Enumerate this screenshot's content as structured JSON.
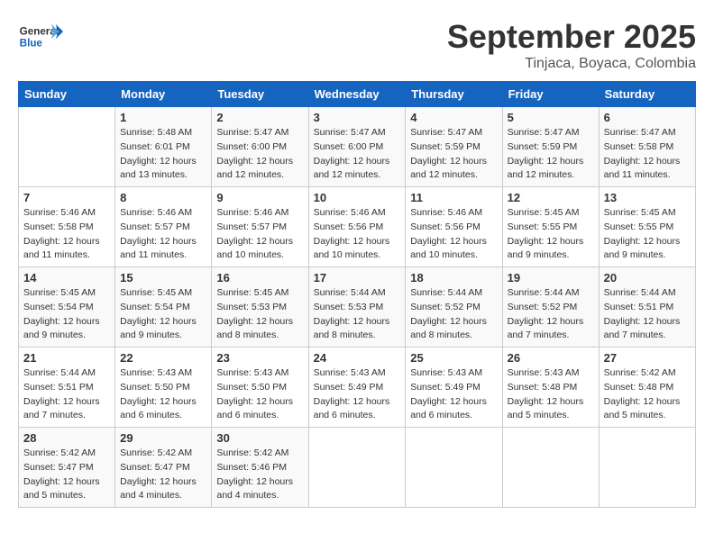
{
  "header": {
    "logo_line1": "General",
    "logo_line2": "Blue",
    "month": "September 2025",
    "location": "Tinjaca, Boyaca, Colombia"
  },
  "days_of_week": [
    "Sunday",
    "Monday",
    "Tuesday",
    "Wednesday",
    "Thursday",
    "Friday",
    "Saturday"
  ],
  "weeks": [
    [
      {
        "day": "",
        "info": ""
      },
      {
        "day": "1",
        "info": "Sunrise: 5:48 AM\nSunset: 6:01 PM\nDaylight: 12 hours\nand 13 minutes."
      },
      {
        "day": "2",
        "info": "Sunrise: 5:47 AM\nSunset: 6:00 PM\nDaylight: 12 hours\nand 12 minutes."
      },
      {
        "day": "3",
        "info": "Sunrise: 5:47 AM\nSunset: 6:00 PM\nDaylight: 12 hours\nand 12 minutes."
      },
      {
        "day": "4",
        "info": "Sunrise: 5:47 AM\nSunset: 5:59 PM\nDaylight: 12 hours\nand 12 minutes."
      },
      {
        "day": "5",
        "info": "Sunrise: 5:47 AM\nSunset: 5:59 PM\nDaylight: 12 hours\nand 12 minutes."
      },
      {
        "day": "6",
        "info": "Sunrise: 5:47 AM\nSunset: 5:58 PM\nDaylight: 12 hours\nand 11 minutes."
      }
    ],
    [
      {
        "day": "7",
        "info": "Sunrise: 5:46 AM\nSunset: 5:58 PM\nDaylight: 12 hours\nand 11 minutes."
      },
      {
        "day": "8",
        "info": "Sunrise: 5:46 AM\nSunset: 5:57 PM\nDaylight: 12 hours\nand 11 minutes."
      },
      {
        "day": "9",
        "info": "Sunrise: 5:46 AM\nSunset: 5:57 PM\nDaylight: 12 hours\nand 10 minutes."
      },
      {
        "day": "10",
        "info": "Sunrise: 5:46 AM\nSunset: 5:56 PM\nDaylight: 12 hours\nand 10 minutes."
      },
      {
        "day": "11",
        "info": "Sunrise: 5:46 AM\nSunset: 5:56 PM\nDaylight: 12 hours\nand 10 minutes."
      },
      {
        "day": "12",
        "info": "Sunrise: 5:45 AM\nSunset: 5:55 PM\nDaylight: 12 hours\nand 9 minutes."
      },
      {
        "day": "13",
        "info": "Sunrise: 5:45 AM\nSunset: 5:55 PM\nDaylight: 12 hours\nand 9 minutes."
      }
    ],
    [
      {
        "day": "14",
        "info": "Sunrise: 5:45 AM\nSunset: 5:54 PM\nDaylight: 12 hours\nand 9 minutes."
      },
      {
        "day": "15",
        "info": "Sunrise: 5:45 AM\nSunset: 5:54 PM\nDaylight: 12 hours\nand 9 minutes."
      },
      {
        "day": "16",
        "info": "Sunrise: 5:45 AM\nSunset: 5:53 PM\nDaylight: 12 hours\nand 8 minutes."
      },
      {
        "day": "17",
        "info": "Sunrise: 5:44 AM\nSunset: 5:53 PM\nDaylight: 12 hours\nand 8 minutes."
      },
      {
        "day": "18",
        "info": "Sunrise: 5:44 AM\nSunset: 5:52 PM\nDaylight: 12 hours\nand 8 minutes."
      },
      {
        "day": "19",
        "info": "Sunrise: 5:44 AM\nSunset: 5:52 PM\nDaylight: 12 hours\nand 7 minutes."
      },
      {
        "day": "20",
        "info": "Sunrise: 5:44 AM\nSunset: 5:51 PM\nDaylight: 12 hours\nand 7 minutes."
      }
    ],
    [
      {
        "day": "21",
        "info": "Sunrise: 5:44 AM\nSunset: 5:51 PM\nDaylight: 12 hours\nand 7 minutes."
      },
      {
        "day": "22",
        "info": "Sunrise: 5:43 AM\nSunset: 5:50 PM\nDaylight: 12 hours\nand 6 minutes."
      },
      {
        "day": "23",
        "info": "Sunrise: 5:43 AM\nSunset: 5:50 PM\nDaylight: 12 hours\nand 6 minutes."
      },
      {
        "day": "24",
        "info": "Sunrise: 5:43 AM\nSunset: 5:49 PM\nDaylight: 12 hours\nand 6 minutes."
      },
      {
        "day": "25",
        "info": "Sunrise: 5:43 AM\nSunset: 5:49 PM\nDaylight: 12 hours\nand 6 minutes."
      },
      {
        "day": "26",
        "info": "Sunrise: 5:43 AM\nSunset: 5:48 PM\nDaylight: 12 hours\nand 5 minutes."
      },
      {
        "day": "27",
        "info": "Sunrise: 5:42 AM\nSunset: 5:48 PM\nDaylight: 12 hours\nand 5 minutes."
      }
    ],
    [
      {
        "day": "28",
        "info": "Sunrise: 5:42 AM\nSunset: 5:47 PM\nDaylight: 12 hours\nand 5 minutes."
      },
      {
        "day": "29",
        "info": "Sunrise: 5:42 AM\nSunset: 5:47 PM\nDaylight: 12 hours\nand 4 minutes."
      },
      {
        "day": "30",
        "info": "Sunrise: 5:42 AM\nSunset: 5:46 PM\nDaylight: 12 hours\nand 4 minutes."
      },
      {
        "day": "",
        "info": ""
      },
      {
        "day": "",
        "info": ""
      },
      {
        "day": "",
        "info": ""
      },
      {
        "day": "",
        "info": ""
      }
    ]
  ]
}
